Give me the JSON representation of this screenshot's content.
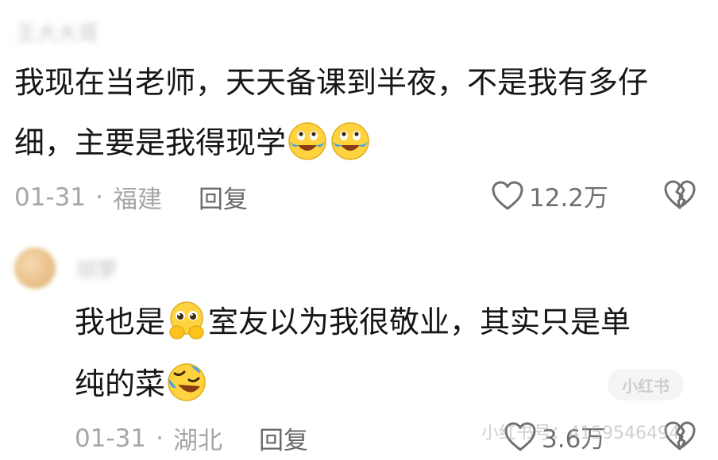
{
  "comments": [
    {
      "username": "王大大哥",
      "text_line1": "我现在当老师，天天备课到半夜，不是我有多仔",
      "text_line2": "细，主要是我得现学",
      "emojis": [
        "crying-laugh-emoji",
        "crying-laugh-emoji"
      ],
      "date": "01-31",
      "separator": "·",
      "location": "福建",
      "reply_label": "回复",
      "like_count": "12.2万"
    },
    {
      "username": "胡萝",
      "text_part1": "我也是",
      "text_part2": "室友以为我很敬业，其实只是单",
      "text_line2": "纯的菜",
      "emojis": [
        "pleading-hands-emoji",
        "rolling-laugh-emoji"
      ],
      "date": "01-31",
      "separator": "·",
      "location": "湖北",
      "reply_label": "回复",
      "like_count": "3.6万"
    }
  ],
  "watermark": {
    "badge": "小红书",
    "text": "小红书号：4159546494"
  },
  "colors": {
    "text": "#161616",
    "meta": "#a6a6a6",
    "reply": "#6a6a6a",
    "emoji_face": "#ffd23f",
    "emoji_tear": "#4aa3df"
  }
}
